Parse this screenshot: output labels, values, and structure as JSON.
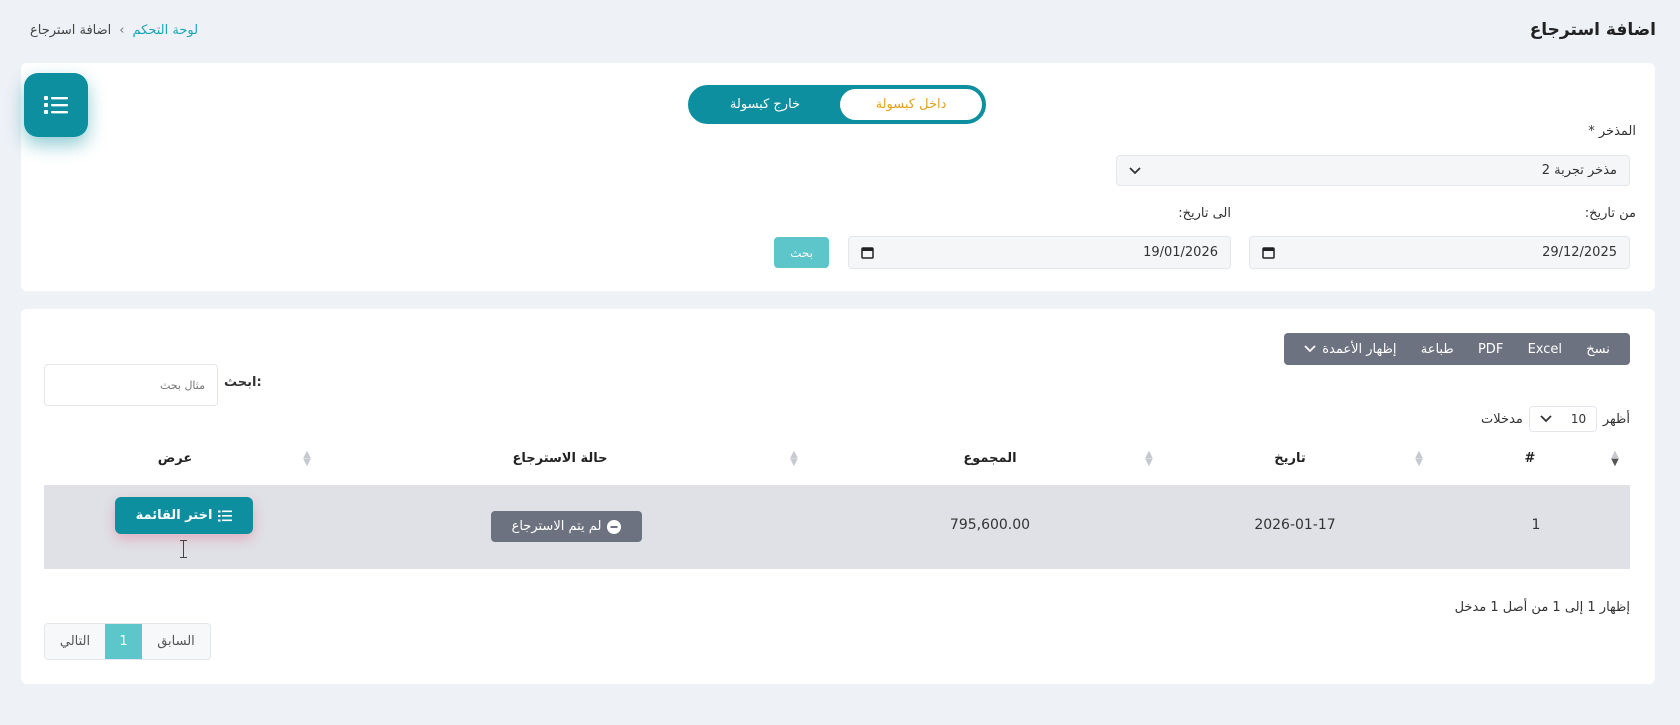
{
  "header": {
    "title": "اضافة استرجاع",
    "breadcrumb": {
      "home": "لوحة التحكم",
      "separator": "›",
      "current": "اضافة استرجاع"
    }
  },
  "filters": {
    "toggle": {
      "inside": "داخل كبسولة",
      "outside": "خارج كبسولة",
      "selected": "inside"
    },
    "warehouse_label": "المذخر *",
    "warehouse_value": "مذخر تجربة 2",
    "from_label": "من تاريخ:",
    "from_value": "29/12/2025",
    "to_label": "الى تاريخ:",
    "to_value": "19/01/2026",
    "search_button": "بحث"
  },
  "table_tools": {
    "copy": "نسخ",
    "excel": "Excel",
    "pdf": "PDF",
    "print": "طباعة",
    "columns": "إظهار الأعمدة",
    "search_label": "ابحث:",
    "search_placeholder": "مثال بحث",
    "show_label": "أظهر",
    "page_length": "10",
    "entries_label": "مدخلات"
  },
  "table": {
    "headers": [
      "#",
      "تاريخ",
      "المجموع",
      "حالة الاسترجاع",
      "عرض"
    ],
    "rows": [
      {
        "num": "1",
        "date": "2026-01-17",
        "total": "795,600.00",
        "status": "لم يتم الاسترجاع",
        "action": "اختر القائمة"
      }
    ]
  },
  "footer": {
    "info": "إظهار 1 إلى 1 من أصل 1 مدخل",
    "prev": "السابق",
    "page": "1",
    "next": "التالي"
  },
  "colors": {
    "primary": "#0e8f9f",
    "accent": "#5cc6cb",
    "toggle_text": "#e5a11c",
    "badge": "#6c727f",
    "row_bg": "#dfe1e6"
  }
}
